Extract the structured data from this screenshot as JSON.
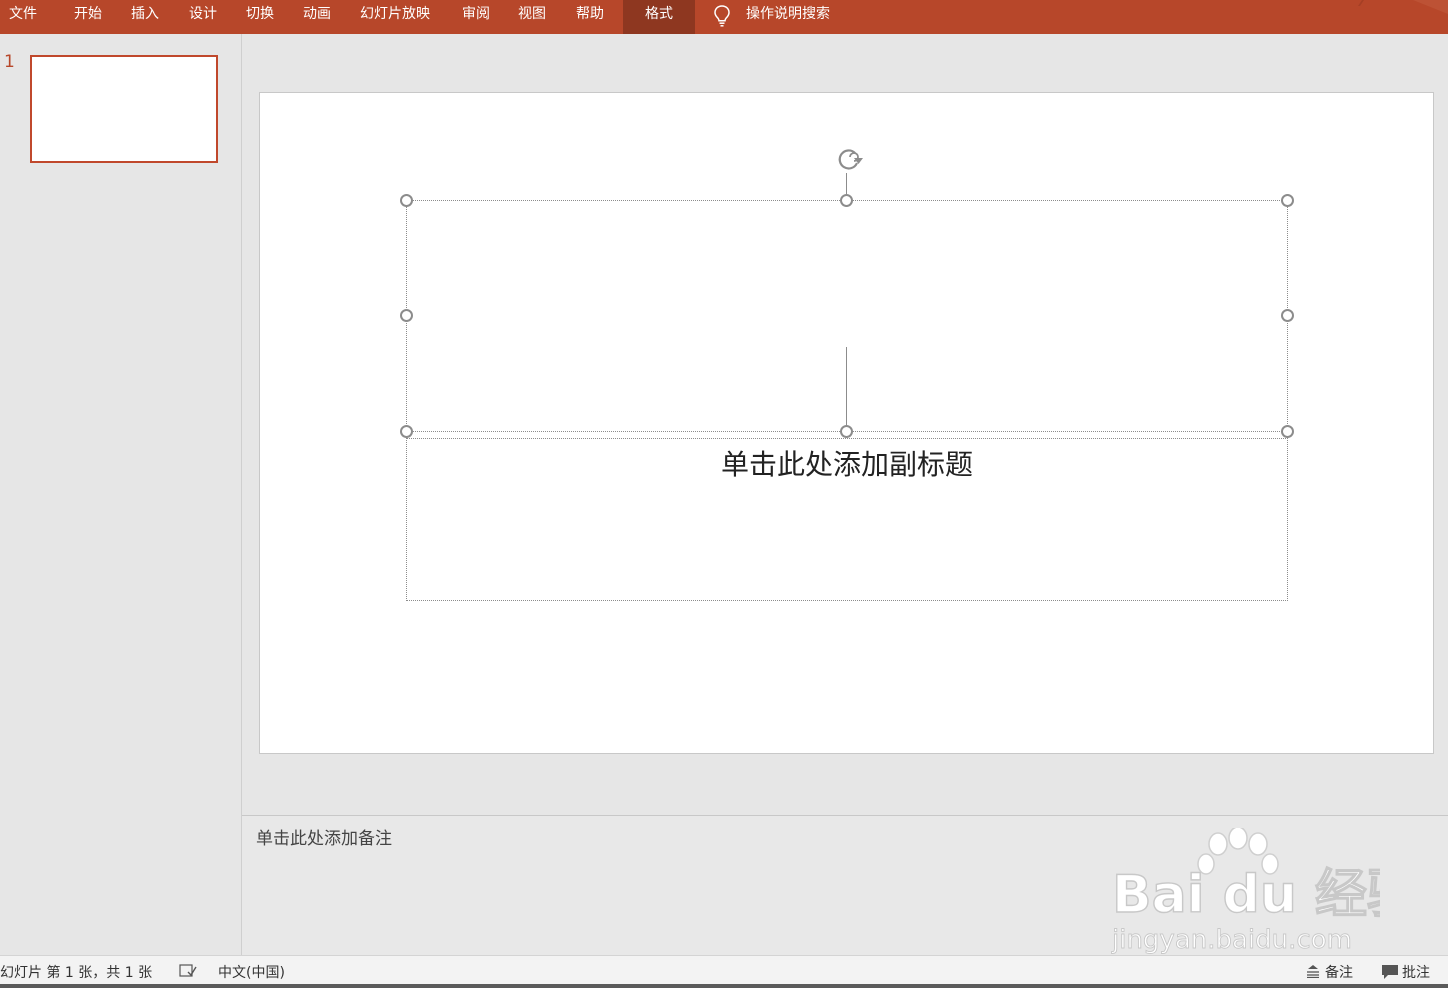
{
  "ribbon": {
    "tabs": [
      {
        "label": "文件"
      },
      {
        "label": "开始"
      },
      {
        "label": "插入"
      },
      {
        "label": "设计"
      },
      {
        "label": "切换"
      },
      {
        "label": "动画"
      },
      {
        "label": "幻灯片放映"
      },
      {
        "label": "审阅"
      },
      {
        "label": "视图"
      },
      {
        "label": "帮助"
      },
      {
        "label": "格式",
        "active": true
      }
    ],
    "tell_me": "操作说明搜索",
    "accent_color": "#b7472a"
  },
  "thumbnails": {
    "items": [
      {
        "number": "1"
      }
    ]
  },
  "slide": {
    "subtitle_placeholder": "单击此处添加副标题"
  },
  "notes": {
    "placeholder": "单击此处添加备注"
  },
  "watermark": {
    "brand": "Bai du 经验",
    "url": "jingyan.baidu.com"
  },
  "statusbar": {
    "slide_info": "幻灯片 第 1 张，共 1 张",
    "language": "中文(中国)",
    "notes_label": "备注",
    "comments_label": "批注"
  }
}
